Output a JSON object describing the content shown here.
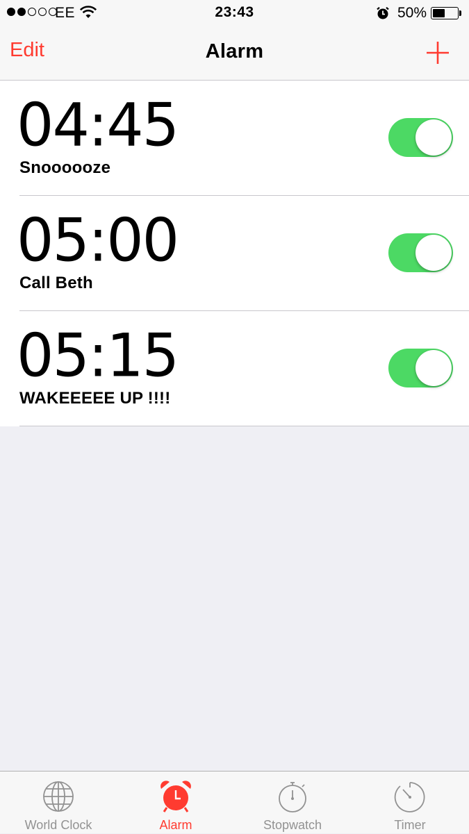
{
  "status": {
    "carrier": "EE",
    "time": "23:43",
    "battery": "50%",
    "battery_level": 0.5,
    "signal_bars": 2
  },
  "nav": {
    "edit": "Edit",
    "title": "Alarm",
    "add_icon": "plus-icon"
  },
  "alarms": [
    {
      "time": "04:45",
      "label": "Snoooooze",
      "enabled": true
    },
    {
      "time": "05:00",
      "label": "Call Beth",
      "enabled": true
    },
    {
      "time": "05:15",
      "label": "WAKEEEEE UP !!!!",
      "enabled": true
    }
  ],
  "tabs": [
    {
      "label": "World Clock",
      "icon": "globe-icon",
      "active": false
    },
    {
      "label": "Alarm",
      "icon": "alarm-clock-icon",
      "active": true
    },
    {
      "label": "Stopwatch",
      "icon": "stopwatch-icon",
      "active": false
    },
    {
      "label": "Timer",
      "icon": "timer-icon",
      "active": false
    }
  ],
  "colors": {
    "accent": "#ff3b30",
    "toggle_on": "#4cd964",
    "background": "#efeff4"
  }
}
